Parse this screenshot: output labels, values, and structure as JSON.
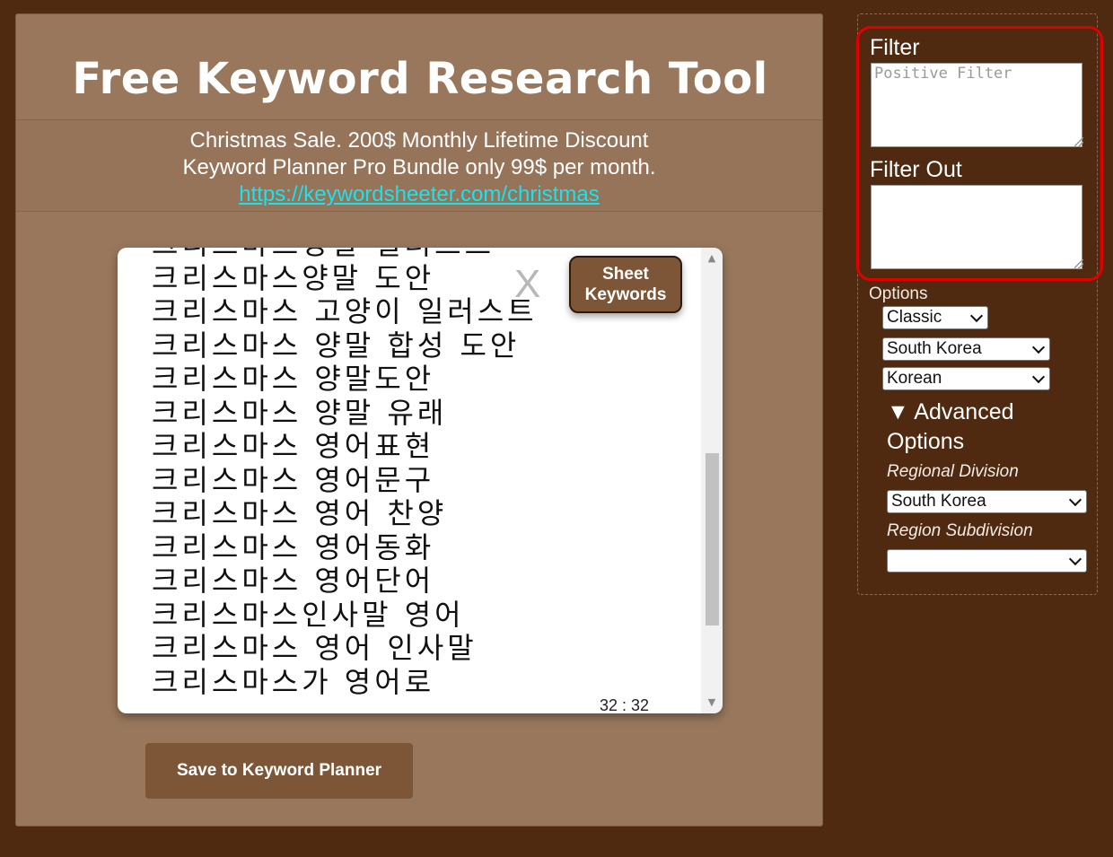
{
  "header": {
    "title": "Free Keyword Research Tool"
  },
  "promo": {
    "line1": "Christmas Sale. 200$ Monthly Lifetime Discount",
    "line2": "Keyword Planner Pro Bundle only 99$ per month.",
    "link": "https://keywordsheeter.com/christmas"
  },
  "keywords": {
    "items": [
      "크리스마스양말 일러스트",
      "크리스마스양말 도안",
      "크리스마스 고양이 일러스트",
      "크리스마스 양말 합성 도안",
      "크리스마스 양말도안",
      "크리스마스 양말 유래",
      "크리스마스 영어표현",
      "크리스마스 영어문구",
      "크리스마스 영어 찬양",
      "크리스마스 영어동화",
      "크리스마스 영어단어",
      "크리스마스인사말 영어",
      "크리스마스 영어 인사말",
      "크리스마스가 영어로"
    ],
    "close_label": "X",
    "sheet_button": "Sheet Keywords",
    "count": "32 : 32",
    "scroll_position": 0.72
  },
  "save_button": "Save to Keyword Planner",
  "sidebar": {
    "filter_label": "Filter",
    "filter_placeholder": "Positive Filter",
    "filter_value": "",
    "filter_out_label": "Filter Out",
    "filter_out_value": "",
    "options_label": "Options",
    "mode": "Classic",
    "country": "South Korea",
    "language": "Korean",
    "advanced_toggle": "▼ Advanced",
    "advanced_options": "Options",
    "regional_division_label": "Regional Division",
    "regional_division": "South Korea",
    "region_subdivision_label": "Region Subdivision",
    "region_subdivision": ""
  },
  "colors": {
    "background": "#4f2a10",
    "panel": "#98775c",
    "button": "#7d5638",
    "link": "#19e3ef",
    "highlight": "#e10000"
  }
}
